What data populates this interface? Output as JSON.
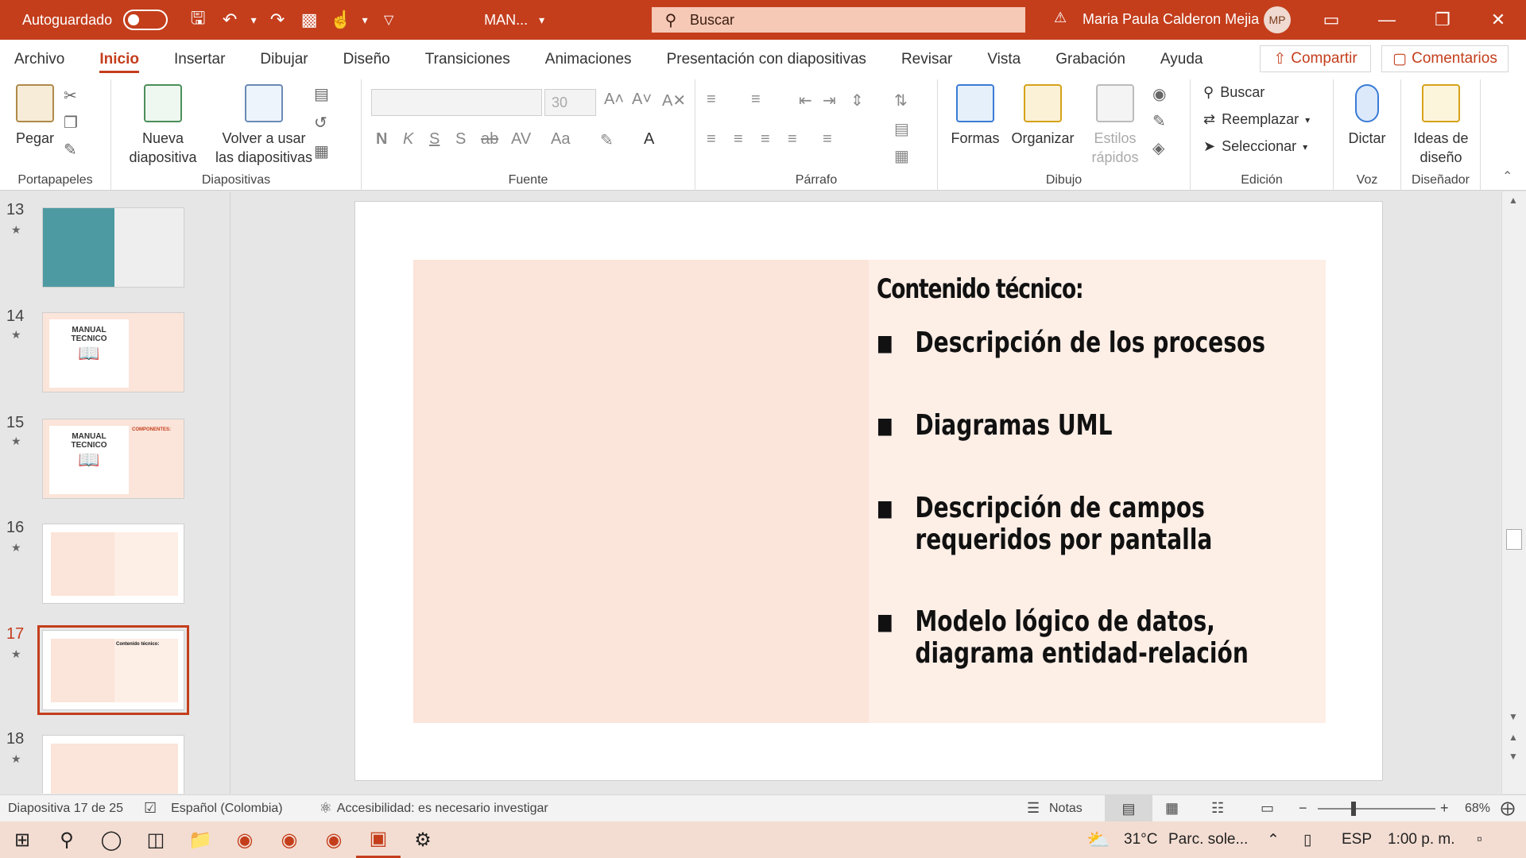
{
  "titlebar": {
    "autosave_label": "Autoguardado",
    "filename": "MAN...",
    "search_placeholder": "Buscar",
    "user_name": "Maria Paula Calderon Mejia",
    "user_initials": "MP"
  },
  "menu": {
    "tabs": [
      "Archivo",
      "Inicio",
      "Insertar",
      "Dibujar",
      "Diseño",
      "Transiciones",
      "Animaciones",
      "Presentación con diapositivas",
      "Revisar",
      "Vista",
      "Grabación",
      "Ayuda"
    ],
    "share": "Compartir",
    "comments": "Comentarios"
  },
  "ribbon": {
    "paste": "Pegar",
    "new_slide_1": "Nueva",
    "new_slide_2": "diapositiva",
    "reuse_1": "Volver a usar",
    "reuse_2": "las diapositivas",
    "font_size": "30",
    "shapes": "Formas",
    "arrange": "Organizar",
    "quick_styles_1": "Estilos",
    "quick_styles_2": "rápidos",
    "find": "Buscar",
    "replace": "Reemplazar",
    "select": "Seleccionar",
    "dictate": "Dictar",
    "design_ideas_1": "Ideas de",
    "design_ideas_2": "diseño",
    "groups": {
      "clipboard": "Portapapeles",
      "slides": "Diapositivas",
      "font": "Fuente",
      "paragraph": "Párrafo",
      "drawing": "Dibujo",
      "editing": "Edición",
      "voice": "Voz",
      "designer": "Diseñador"
    }
  },
  "thumbnails": [
    {
      "num": "13"
    },
    {
      "num": "14",
      "title_1": "MANUAL",
      "title_2": "TECNICO"
    },
    {
      "num": "15",
      "title_1": "MANUAL",
      "title_2": "TECNICO",
      "heading": "COMPONENTES:"
    },
    {
      "num": "16"
    },
    {
      "num": "17",
      "heading": "Contenido técnico:"
    },
    {
      "num": "18"
    }
  ],
  "slide": {
    "title": "Contenido técnico:",
    "bullets": [
      "Descripción de los procesos",
      "Diagramas UML",
      "Descripción de campos requeridos por pantalla",
      "Modelo lógico de datos, diagrama entidad-relación"
    ]
  },
  "status": {
    "slide_info": "Diapositiva 17 de 25",
    "language": "Español (Colombia)",
    "accessibility": "Accesibilidad: es necesario investigar",
    "notes": "Notas",
    "zoom": "68%"
  },
  "taskbar": {
    "weather_temp": "31°C",
    "weather_desc": "Parc. sole...",
    "lang": "ESP",
    "time": "1:00 p. m."
  },
  "colors": {
    "accent": "#c43e1c",
    "slide_left_panel": "#fbe4d9",
    "slide_right_panel": "#fdeee6"
  }
}
